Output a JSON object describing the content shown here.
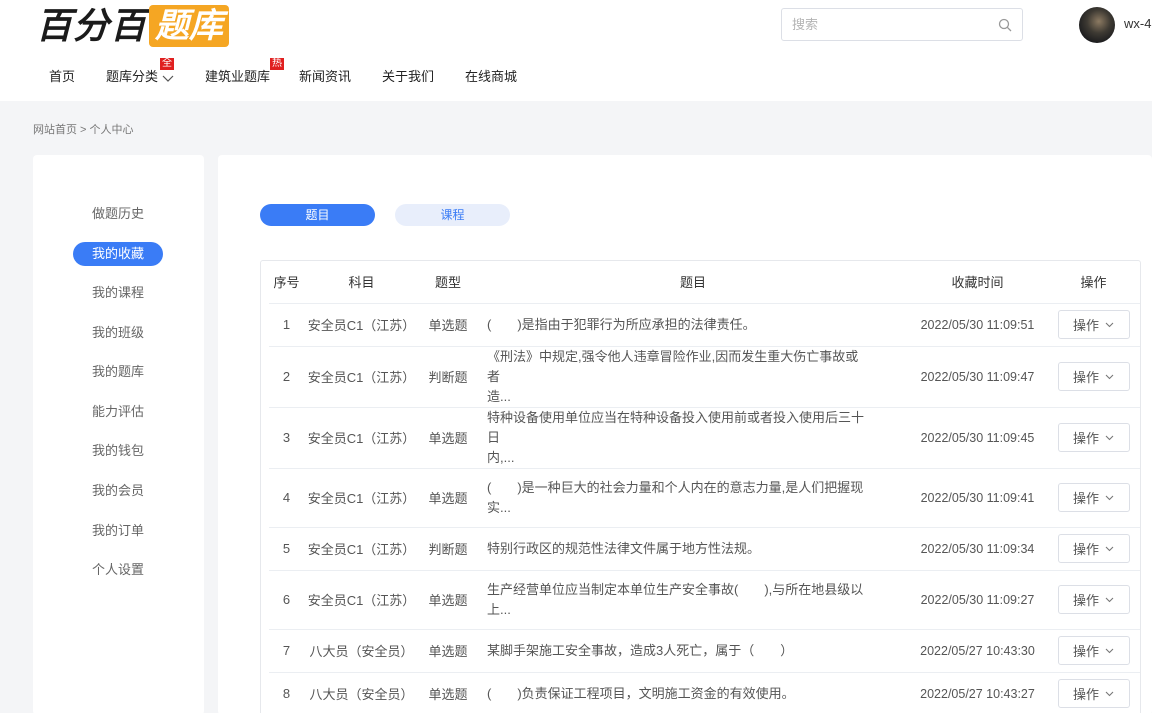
{
  "header": {
    "logo_text": "百分百",
    "logo_highlight": "题库",
    "search_placeholder": "搜索",
    "username": "wx-4",
    "accent": "#f5a623"
  },
  "nav": {
    "items": [
      {
        "label": "首页"
      },
      {
        "label": "题库分类",
        "badge": "全"
      },
      {
        "label": "建筑业题库",
        "badge": "热"
      },
      {
        "label": "新闻资讯"
      },
      {
        "label": "关于我们"
      },
      {
        "label": "在线商城"
      }
    ]
  },
  "breadcrumb": "网站首页  > 个人中心",
  "sidebar": {
    "items": [
      {
        "label": "做题历史"
      },
      {
        "label": "我的收藏",
        "active": true
      },
      {
        "label": "我的课程"
      },
      {
        "label": "我的班级"
      },
      {
        "label": "我的题库"
      },
      {
        "label": "能力评估"
      },
      {
        "label": "我的钱包"
      },
      {
        "label": "我的会员"
      },
      {
        "label": "我的订单"
      },
      {
        "label": "个人设置"
      }
    ],
    "active_color": "#3a7cf6"
  },
  "tabs": [
    {
      "label": "题目",
      "active": true
    },
    {
      "label": "课程",
      "active": false
    }
  ],
  "table": {
    "headers": [
      "序号",
      "科目",
      "题型",
      "题目",
      "收藏时间",
      "操作"
    ],
    "op_label": "操作",
    "rows": [
      {
        "no": "1",
        "subject": "安全员C1（江苏）",
        "type": "单选题",
        "q1": "(　　)是指由于犯罪行为所应承担的法律责任。",
        "q2": "",
        "time": "2022/05/30 11:09:51"
      },
      {
        "no": "2",
        "subject": "安全员C1（江苏）",
        "type": "判断题",
        "q1": "《刑法》中规定,强令他人违章冒险作业,因而发生重大伤亡事故或者",
        "q2": "造...",
        "time": "2022/05/30 11:09:47"
      },
      {
        "no": "3",
        "subject": "安全员C1（江苏）",
        "type": "单选题",
        "q1": "特种设备使用单位应当在特种设备投入使用前或者投入使用后三十日",
        "q2": "内,...",
        "time": "2022/05/30 11:09:45"
      },
      {
        "no": "4",
        "subject": "安全员C1（江苏）",
        "type": "单选题",
        "q1": "(　　)是一种巨大的社会力量和个人内在的意志力量,是人们把握现",
        "q2": "实...",
        "time": "2022/05/30 11:09:41"
      },
      {
        "no": "5",
        "subject": "安全员C1（江苏）",
        "type": "判断题",
        "q1": "特别行政区的规范性法律文件属于地方性法规。",
        "q2": "",
        "time": "2022/05/30 11:09:34"
      },
      {
        "no": "6",
        "subject": "安全员C1（江苏）",
        "type": "单选题",
        "q1": "生产经营单位应当制定本单位生产安全事故(　　),与所在地县级以",
        "q2": "上...",
        "time": "2022/05/30 11:09:27"
      },
      {
        "no": "7",
        "subject": "八大员（安全员）",
        "type": "单选题",
        "q1": "某脚手架施工安全事故，造成3人死亡，属于（　　）",
        "q2": "",
        "time": "2022/05/27 10:43:30"
      },
      {
        "no": "8",
        "subject": "八大员（安全员）",
        "type": "单选题",
        "q1": "(　　)负责保证工程项目，文明施工资金的有效使用。",
        "q2": "",
        "time": "2022/05/27 10:43:27"
      }
    ]
  }
}
